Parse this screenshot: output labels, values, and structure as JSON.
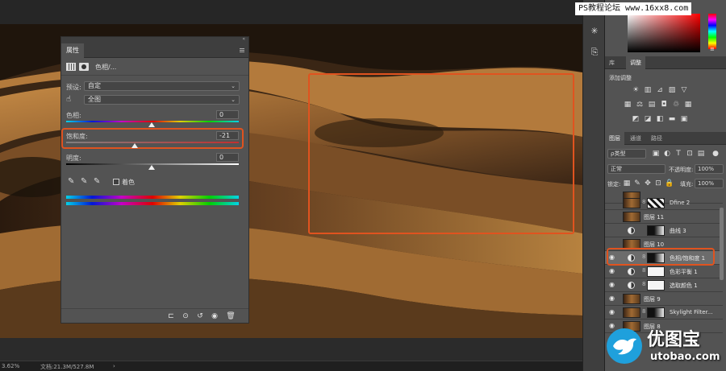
{
  "watermark": {
    "site_text": "PS教程论坛 www.16xx8.com",
    "logo_text": "优图宝",
    "logo_url": "utobao.com"
  },
  "status": {
    "zoom": "3.62%",
    "doc": "文档:21.3M/527.8M",
    "arrow": "›"
  },
  "properties": {
    "tab": "属性",
    "header_title": "色相/...",
    "preset_label": "预设:",
    "preset_value": "自定",
    "channel_value": "全图",
    "hue_label": "色相:",
    "hue_value": "0",
    "saturation_label": "饱和度:",
    "saturation_value": "-21",
    "lightness_label": "明度:",
    "lightness_value": "0",
    "colorize_label": "着色"
  },
  "adjustments": {
    "tabs": [
      "库",
      "调整"
    ],
    "add_label": "添加调整"
  },
  "layers": {
    "tabs": [
      "图层",
      "通道",
      "路径"
    ],
    "filter_type": "ρ类型",
    "blend_mode": "正常",
    "opacity_label": "不透明度:",
    "opacity_value": "100%",
    "lock_label": "锁定:",
    "fill_label": "填充:",
    "fill_value": "100%",
    "items": [
      {
        "name": "Dfine 2"
      },
      {
        "name": "图层 11"
      },
      {
        "name": "曲线 3"
      },
      {
        "name": "图层 10"
      },
      {
        "name": "色相/饱和度 1"
      },
      {
        "name": "色彩平衡 1"
      },
      {
        "name": "选取颜色 1"
      },
      {
        "name": "图层 9"
      },
      {
        "name": "Skylight Filter..."
      },
      {
        "name": "图层 8"
      }
    ]
  },
  "chart_data": {
    "type": "table",
    "saturation": -21,
    "hue": 0,
    "lightness": 0
  }
}
